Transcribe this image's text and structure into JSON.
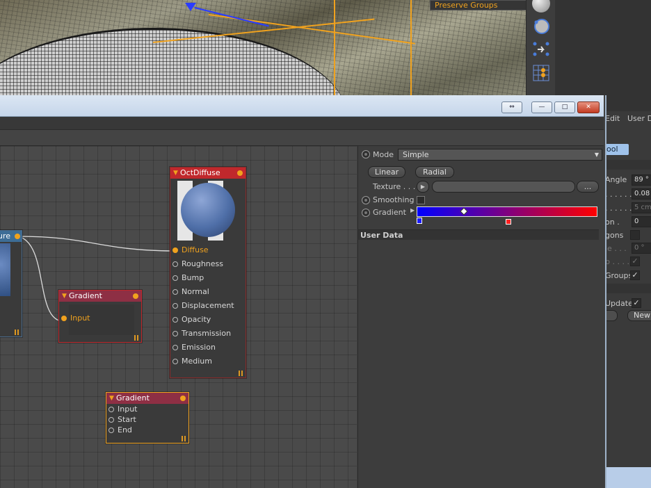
{
  "viewport": {
    "overlay_label": "Preserve Groups"
  },
  "right_panel": {
    "menu": [
      "Edit",
      "User D"
    ],
    "tool_button": "ool",
    "rows": [
      {
        "label": "Angle",
        "value": "89 °"
      },
      {
        "label": ". . . . . .",
        "value": "0.08"
      },
      {
        "label": ". . . . . .",
        "value": "5 cm"
      },
      {
        "label": "on .",
        "value": "0"
      },
      {
        "label": "gons",
        "value": ""
      },
      {
        "label": "le . . .",
        "value": "0 °"
      },
      {
        "label": "p . . . .",
        "value": "✓"
      },
      {
        "label": "Groups",
        "value": "✓"
      }
    ],
    "update_label": "Update",
    "update_check": "✓",
    "new_button": "New"
  },
  "window": {
    "buttons": {
      "restore": "⇔",
      "minimize": "—",
      "maximize": "□",
      "close": "✕"
    }
  },
  "nodes": {
    "partial": {
      "title": "ure"
    },
    "octdiffuse": {
      "title": "OctDiffuse",
      "ports": [
        "Diffuse",
        "Roughness",
        "Bump",
        "Normal",
        "Displacement",
        "Opacity",
        "Transmission",
        "Emission",
        "Medium"
      ]
    },
    "gradient1": {
      "title": "Gradient",
      "ports": [
        "Input"
      ]
    },
    "gradient2": {
      "title": "Gradient",
      "ports": [
        "Input",
        "Start",
        "End"
      ]
    }
  },
  "attributes": {
    "mode_label": "Mode",
    "mode_value": "Simple",
    "linear_button": "Linear",
    "radial_button": "Radial",
    "texture_label": "Texture . . .",
    "texture_more": "...",
    "smoothing_label": "Smoothing",
    "gradient_label": "Gradient",
    "gradient_colors": {
      "start": "#0000ff",
      "end": "#ff0000"
    },
    "user_data_header": "User Data"
  }
}
